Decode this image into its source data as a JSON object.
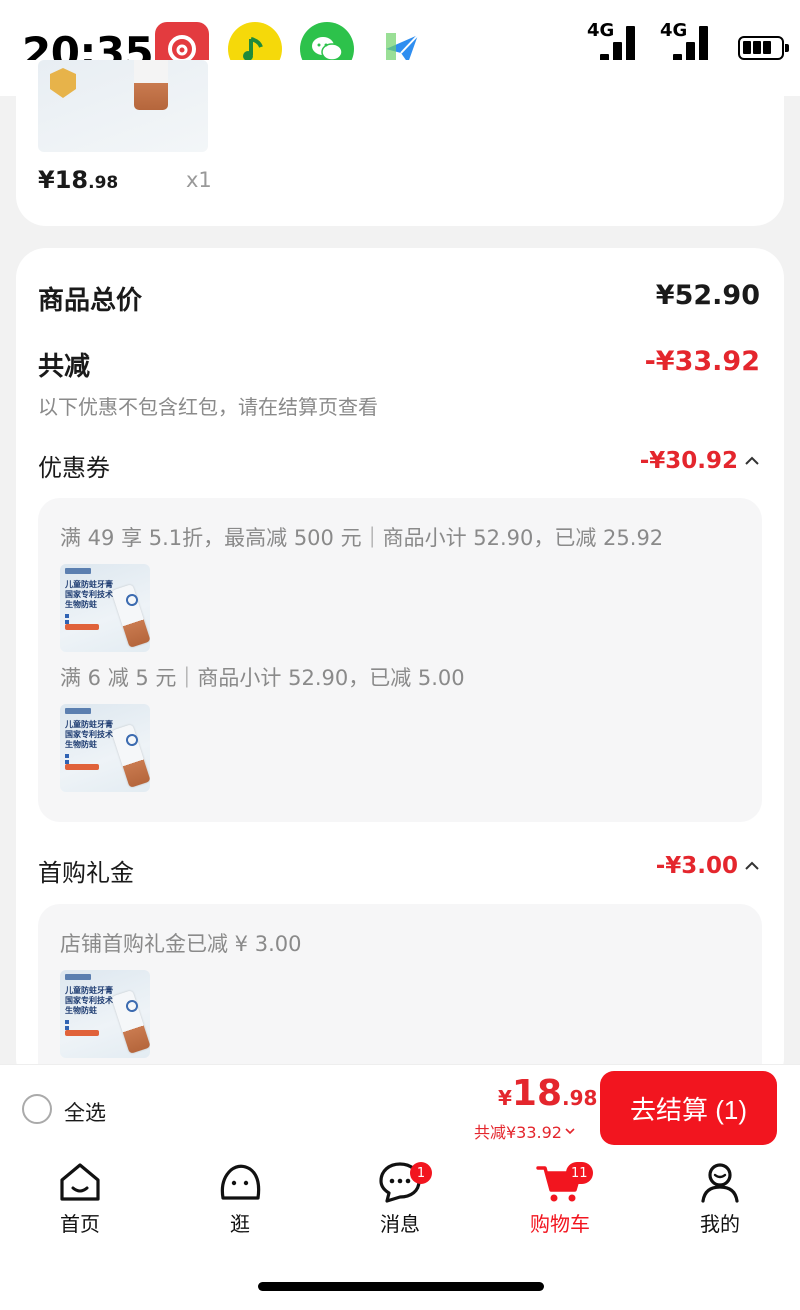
{
  "status_bar": {
    "time": "20:35",
    "network_1": "4G",
    "network_2": "4G",
    "apps": [
      "netease-music-icon",
      "qq-music-icon",
      "wechat-icon",
      "mail-icon"
    ]
  },
  "top_item": {
    "price_main": "¥18",
    "price_decimal": ".98",
    "quantity": "x1"
  },
  "summary": {
    "total_label": "商品总价",
    "total_value": "¥52.90",
    "discount_label": "共减",
    "discount_value": "-¥33.92",
    "discount_note": "以下优惠不包含红包，请在结算页查看",
    "coupon_label": "优惠券",
    "coupon_value": "-¥30.92",
    "coupon_rules": [
      "满 49 享 5.1折，最高减 500 元｜商品小计 52.90，已减 25.92",
      "满 6 减 5 元｜商品小计 52.90，已减 5.00"
    ],
    "gift_label": "首购礼金",
    "gift_value": "-¥3.00",
    "gift_rules": [
      "店铺首购礼金已减 ¥ 3.00"
    ],
    "thumb": {
      "line1": "儿童防蛀牙膏",
      "line2": "国家专利技术",
      "line3": "生物防蛀"
    }
  },
  "bottom_bar": {
    "select_all": "全选",
    "total_symbol": "¥",
    "total_main": "18",
    "total_decimal": ".98",
    "total_discount": "共减¥33.92",
    "checkout": "去结算 (1)"
  },
  "tabs": [
    {
      "label": "首页",
      "icon": "home-icon"
    },
    {
      "label": "逛",
      "icon": "browse-icon"
    },
    {
      "label": "消息",
      "icon": "message-icon",
      "badge": "1"
    },
    {
      "label": "购物车",
      "icon": "cart-icon",
      "badge": "11",
      "active": true
    },
    {
      "label": "我的",
      "icon": "profile-icon"
    }
  ],
  "colors": {
    "accent": "#f2151f",
    "discount_red": "#e4262d",
    "text_gray": "#8a8a8a"
  }
}
